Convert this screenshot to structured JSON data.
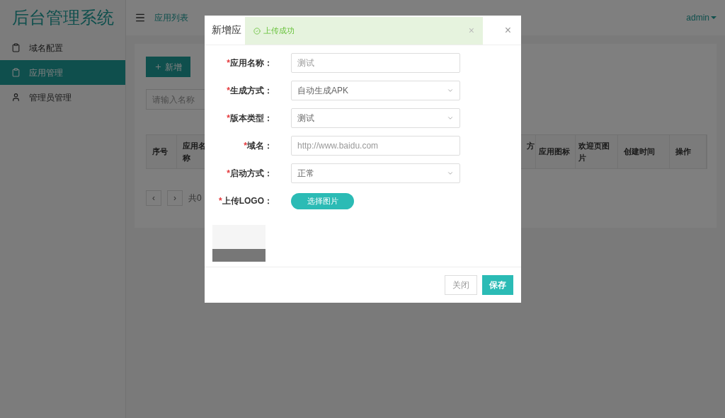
{
  "sidebar": {
    "title": "后台管理系统",
    "items": [
      {
        "label": "域名配置",
        "selected": false
      },
      {
        "label": "应用管理",
        "selected": true
      },
      {
        "label": "管理员管理",
        "selected": false
      }
    ]
  },
  "topbar": {
    "page_title": "应用列表",
    "user": "admin"
  },
  "content": {
    "add_button": "新增",
    "search": {
      "placeholder": "请输入名称"
    },
    "table": {
      "columns": [
        {
          "label": "序号"
        },
        {
          "label": "应用名称"
        },
        {
          "label": "方"
        },
        {
          "label": "应用图标"
        },
        {
          "label": "欢迎页图片"
        },
        {
          "label": "创建时间"
        },
        {
          "label": "操作"
        }
      ]
    },
    "pagination": {
      "prev": "‹",
      "next": "›",
      "summary": "共0"
    }
  },
  "dialog": {
    "title": "新增应",
    "close": "×",
    "fields": [
      {
        "kind": "input",
        "label": "应用名称：",
        "required_mark": "*",
        "placeholder": "测试"
      },
      {
        "kind": "select",
        "label": "生成方式：",
        "required_mark": "*",
        "value": "自动生成APK"
      },
      {
        "kind": "select",
        "label": "版本类型：",
        "required_mark": "*",
        "value": "测试"
      },
      {
        "kind": "input",
        "label": "域名：",
        "required_mark": "*",
        "placeholder": "http://www.baidu.com"
      },
      {
        "kind": "select",
        "label": "启动方式：",
        "required_mark": "*",
        "value": "正常"
      },
      {
        "kind": "upload",
        "label": "上传LOGO：",
        "required_mark": "*",
        "button": "选择图片"
      }
    ],
    "buttons": [
      {
        "label": "关闭",
        "primary": false
      },
      {
        "label": "保存",
        "primary": true
      }
    ]
  },
  "toast": {
    "message": "上传成功",
    "close": "×"
  }
}
